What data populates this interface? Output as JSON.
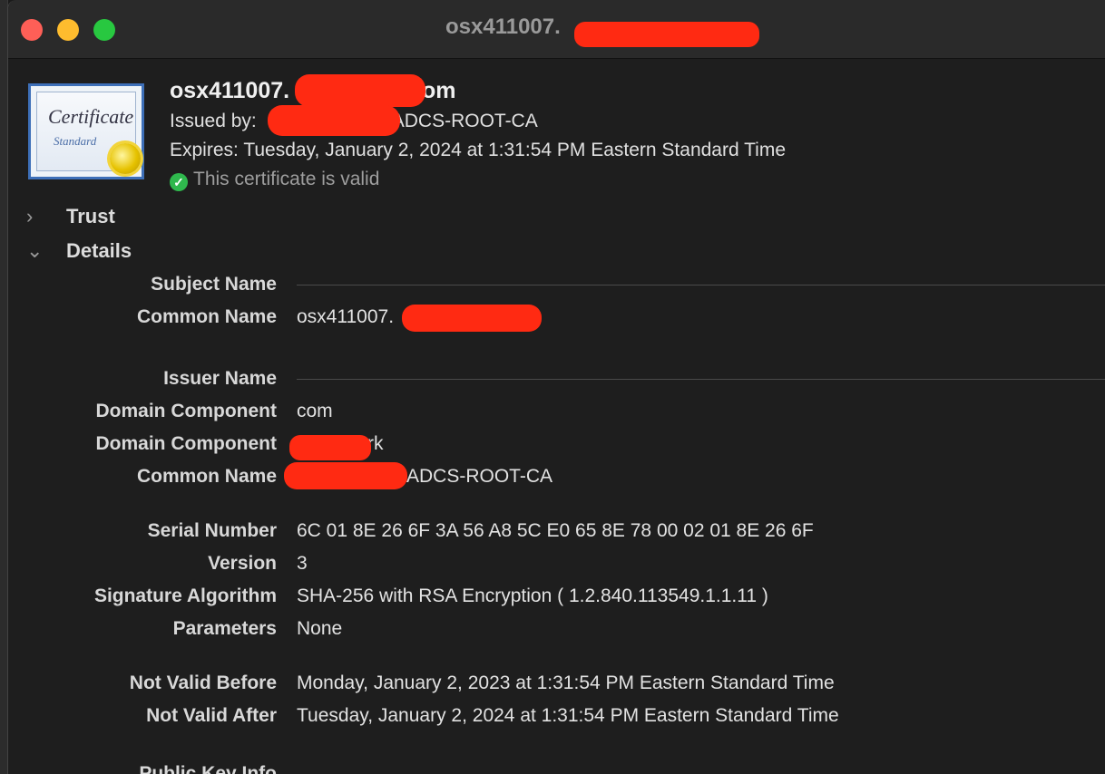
{
  "window": {
    "title": "osx411007."
  },
  "header": {
    "cert_icon_word": "Certificate",
    "cert_icon_sub": "Standard",
    "title_prefix": "osx411007.",
    "title_suffix": "com",
    "issued_by_prefix": "Issued by:",
    "issued_by_suffix": "-ADCS-ROOT-CA",
    "expires": "Expires: Tuesday, January 2, 2024 at 1:31:54 PM Eastern Standard Time",
    "valid_text": "This certificate is valid"
  },
  "sections": {
    "trust": "Trust",
    "details": "Details"
  },
  "details": {
    "subject_name": "Subject Name",
    "common_name_label": "Common Name",
    "common_name_value": "osx411007.",
    "issuer_name": "Issuer Name",
    "dc1_label": "Domain Component",
    "dc1_value": "com",
    "dc2_label": "Domain Component",
    "dc2_value": "rk",
    "issuer_cn_label": "Common Name",
    "issuer_cn_value": "-ADCS-ROOT-CA",
    "serial_label": "Serial Number",
    "serial_value": "6C 01 8E 26 6F 3A 56 A8 5C E0 65 8E 78 00 02 01 8E 26 6F",
    "version_label": "Version",
    "version_value": "3",
    "sigalg_label": "Signature Algorithm",
    "sigalg_value": "SHA-256 with RSA Encryption ( 1.2.840.113549.1.1.11 )",
    "params_label": "Parameters",
    "params_value": "None",
    "not_before_label": "Not Valid Before",
    "not_before_value": "Monday, January 2, 2023 at 1:31:54 PM Eastern Standard Time",
    "not_after_label": "Not Valid After",
    "not_after_value": "Tuesday, January 2, 2024 at 1:31:54 PM Eastern Standard Time",
    "public_key_label": "Public Key Info"
  },
  "icons": {
    "trust_chevron": "chevron-right-icon",
    "details_chevron": "chevron-down-icon",
    "valid": "check-circle-icon",
    "certificate": "certificate-icon"
  },
  "colors": {
    "close": "#fe5f57",
    "minimize": "#febc2e",
    "maximize": "#28c840",
    "valid_green": "#2fb84d",
    "redaction": "#ff2a12"
  }
}
